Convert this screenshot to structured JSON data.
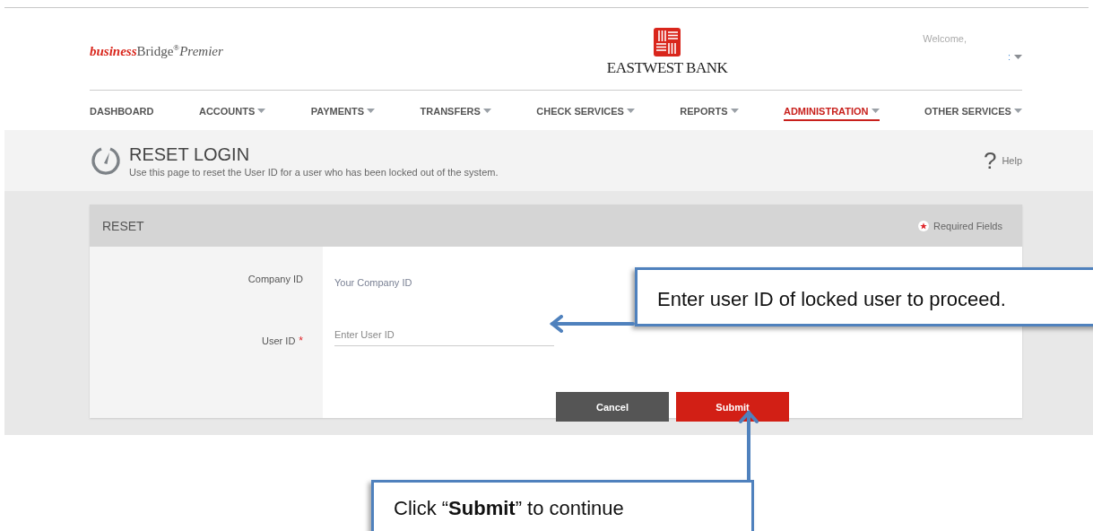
{
  "brand": {
    "parts": [
      {
        "text": "business",
        "kind": "emphasis"
      },
      {
        "text": "Bridge",
        "kind": "plain"
      },
      {
        "text": "®",
        "kind": "super"
      },
      {
        "text": "Premier",
        "kind": "italic"
      }
    ]
  },
  "bank_logo": {
    "text": "EASTWEST BANK"
  },
  "user_menu": {
    "greeting": "Welcome,",
    "user_name": ":"
  },
  "nav": [
    {
      "label": "DASHBOARD",
      "has_menu": false,
      "selected": false
    },
    {
      "label": "ACCOUNTS",
      "has_menu": true,
      "selected": false
    },
    {
      "label": "PAYMENTS",
      "has_menu": true,
      "selected": false
    },
    {
      "label": "TRANSFERS",
      "has_menu": true,
      "selected": false
    },
    {
      "label": "CHECK SERVICES",
      "has_menu": true,
      "selected": false
    },
    {
      "label": "REPORTS",
      "has_menu": true,
      "selected": false
    },
    {
      "label": "ADMINISTRATION",
      "has_menu": true,
      "selected": true
    },
    {
      "label": "OTHER SERVICES",
      "has_menu": true,
      "selected": false
    }
  ],
  "page_header": {
    "title": "RESET LOGIN",
    "description": "Use this page to reset the User ID for a user who has been locked out of the system.",
    "help_glyph": "?",
    "help_label": "Help"
  },
  "panel": {
    "title": "RESET",
    "required_note": "Required Fields",
    "fields": [
      {
        "label": "Company ID",
        "required": false,
        "kind": "text",
        "value": "Your Company ID"
      },
      {
        "label": "User ID",
        "required": true,
        "kind": "input",
        "placeholder": "Enter User ID"
      }
    ],
    "required_mark": "*",
    "buttons": [
      {
        "label": "Cancel",
        "kind": "secondary"
      },
      {
        "label": "Submit",
        "kind": "primary"
      }
    ]
  },
  "callouts": [
    {
      "text": "Enter user ID of locked user to proceed.",
      "kind": "left"
    },
    {
      "text": "Click “**Submit**” to continue",
      "kind": "up"
    }
  ]
}
